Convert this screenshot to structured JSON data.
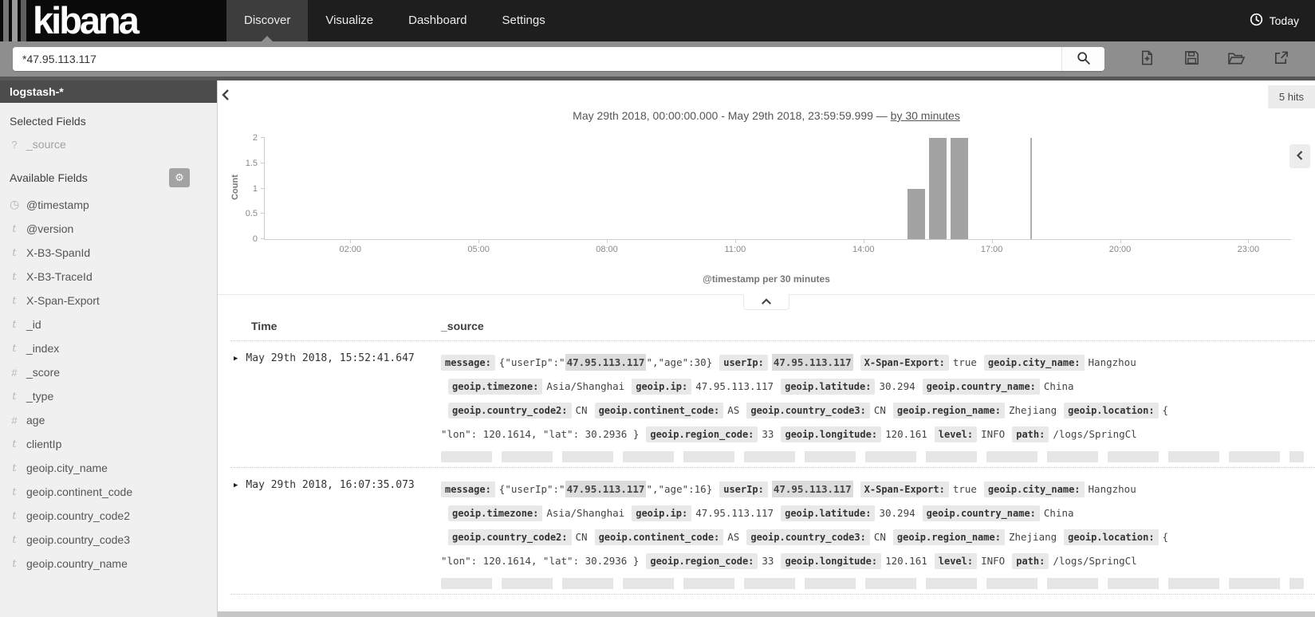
{
  "navbar": {
    "logo": "kibana",
    "tabs": [
      {
        "label": "Discover",
        "active": true
      },
      {
        "label": "Visualize",
        "active": false
      },
      {
        "label": "Dashboard",
        "active": false
      },
      {
        "label": "Settings",
        "active": false
      }
    ],
    "time_label": "Today",
    "time_icon": "clock-icon"
  },
  "search": {
    "value": "*47.95.113.117",
    "buttons": [
      "search",
      "new-search",
      "save-search",
      "open-search",
      "share"
    ]
  },
  "sidebar": {
    "index_pattern": "logstash-*",
    "selected_label": "Selected Fields",
    "selected_fields": [
      {
        "type": "q",
        "name": "_source"
      }
    ],
    "available_label": "Available Fields",
    "available_fields": [
      {
        "type": "clock",
        "name": "@timestamp"
      },
      {
        "type": "t",
        "name": "@version"
      },
      {
        "type": "t",
        "name": "X-B3-SpanId"
      },
      {
        "type": "t",
        "name": "X-B3-TraceId"
      },
      {
        "type": "t",
        "name": "X-Span-Export"
      },
      {
        "type": "t",
        "name": "_id"
      },
      {
        "type": "t",
        "name": "_index"
      },
      {
        "type": "number",
        "name": "_score"
      },
      {
        "type": "t",
        "name": "_type"
      },
      {
        "type": "number",
        "name": "age"
      },
      {
        "type": "t",
        "name": "clientIp"
      },
      {
        "type": "t",
        "name": "geoip.city_name"
      },
      {
        "type": "t",
        "name": "geoip.continent_code"
      },
      {
        "type": "t",
        "name": "geoip.country_code2"
      },
      {
        "type": "t",
        "name": "geoip.country_code3"
      },
      {
        "type": "t",
        "name": "geoip.country_name"
      }
    ]
  },
  "results": {
    "hits": "5 hits",
    "time_range_title": "May 29th 2018, 00:00:00.000 - May 29th 2018, 23:59:59.999",
    "separator": "—",
    "interval_link": "by 30 minutes",
    "xaxis_caption": "@timestamp per 30 minutes"
  },
  "chart_data": {
    "type": "bar",
    "title": "May 29th 2018, 00:00:00.000 - May 29th 2018, 23:59:59.999 — by 30 minutes",
    "xlabel": "@timestamp per 30 minutes",
    "ylabel": "Count",
    "ylim": [
      0,
      2
    ],
    "y_ticks": [
      0,
      0.5,
      1,
      1.5,
      2
    ],
    "x_hours_range": [
      0,
      24
    ],
    "x_ticks": [
      "02:00",
      "05:00",
      "08:00",
      "11:00",
      "14:00",
      "17:00",
      "20:00",
      "23:00"
    ],
    "x_tick_hours": [
      2,
      5,
      8,
      11,
      14,
      17,
      20,
      23
    ],
    "bucket_minutes": 30,
    "buckets": [
      {
        "time": "15:00",
        "hour": 15.0,
        "count": 1
      },
      {
        "time": "15:30",
        "hour": 15.5,
        "count": 2
      },
      {
        "time": "16:00",
        "hour": 16.0,
        "count": 2
      }
    ],
    "marker_hour": 17.9,
    "bar_color": "#a3a3a3",
    "grid": false,
    "legend": false,
    "total_hits": 5
  },
  "table": {
    "columns": [
      "Time",
      "_source"
    ],
    "expand_icon": "▶",
    "rows": [
      {
        "time": "May 29th 2018, 15:52:41.647",
        "segments": [
          {
            "k": "message:"
          },
          {
            "t": "{\"userIp\":\""
          },
          {
            "h": "47.95.113.117"
          },
          {
            "t": "\",\"age\":30}"
          },
          {
            "k": "userIp:"
          },
          {
            "h": "47.95.113.117"
          },
          {
            "k": "X-Span-Export:"
          },
          {
            "t": "true"
          },
          {
            "k": "geoip.city_name:"
          },
          {
            "t": "Hangzhou"
          },
          {
            "br": true
          },
          {
            "k": "geoip.timezone:"
          },
          {
            "t": "Asia/Shanghai"
          },
          {
            "k": "geoip.ip:"
          },
          {
            "t": "47.95.113.117"
          },
          {
            "k": "geoip.latitude:"
          },
          {
            "t": "30.294"
          },
          {
            "k": "geoip.country_name:"
          },
          {
            "t": "China"
          },
          {
            "br": true
          },
          {
            "k": "geoip.country_code2:"
          },
          {
            "t": "CN"
          },
          {
            "k": "geoip.continent_code:"
          },
          {
            "t": "AS"
          },
          {
            "k": "geoip.country_code3:"
          },
          {
            "t": "CN"
          },
          {
            "k": "geoip.region_name:"
          },
          {
            "t": "Zhejiang"
          },
          {
            "k": "geoip.location:"
          },
          {
            "t": "{"
          },
          {
            "br": true
          },
          {
            "t": "\"lon\": 120.1614, \"lat\": 30.2936 }"
          },
          {
            "k": "geoip.region_code:"
          },
          {
            "t": "33"
          },
          {
            "k": "geoip.longitude:"
          },
          {
            "t": "120.161"
          },
          {
            "k": "level:"
          },
          {
            "t": "INFO"
          },
          {
            "k": "path:"
          },
          {
            "t": "/logs/SpringCl"
          }
        ]
      },
      {
        "time": "May 29th 2018, 16:07:35.073",
        "segments": [
          {
            "k": "message:"
          },
          {
            "t": "{\"userIp\":\""
          },
          {
            "h": "47.95.113.117"
          },
          {
            "t": "\",\"age\":16}"
          },
          {
            "k": "userIp:"
          },
          {
            "h": "47.95.113.117"
          },
          {
            "k": "X-Span-Export:"
          },
          {
            "t": "true"
          },
          {
            "k": "geoip.city_name:"
          },
          {
            "t": "Hangzhou"
          },
          {
            "br": true
          },
          {
            "k": "geoip.timezone:"
          },
          {
            "t": "Asia/Shanghai"
          },
          {
            "k": "geoip.ip:"
          },
          {
            "t": "47.95.113.117"
          },
          {
            "k": "geoip.latitude:"
          },
          {
            "t": "30.294"
          },
          {
            "k": "geoip.country_name:"
          },
          {
            "t": "China"
          },
          {
            "br": true
          },
          {
            "k": "geoip.country_code2:"
          },
          {
            "t": "CN"
          },
          {
            "k": "geoip.continent_code:"
          },
          {
            "t": "AS"
          },
          {
            "k": "geoip.country_code3:"
          },
          {
            "t": "CN"
          },
          {
            "k": "geoip.region_name:"
          },
          {
            "t": "Zhejiang"
          },
          {
            "k": "geoip.location:"
          },
          {
            "t": "{"
          },
          {
            "br": true
          },
          {
            "t": "\"lon\": 120.1614, \"lat\": 30.2936 }"
          },
          {
            "k": "geoip.region_code:"
          },
          {
            "t": "33"
          },
          {
            "k": "geoip.longitude:"
          },
          {
            "t": "120.161"
          },
          {
            "k": "level:"
          },
          {
            "t": "INFO"
          },
          {
            "k": "path:"
          },
          {
            "t": "/logs/SpringCl"
          }
        ]
      }
    ]
  }
}
